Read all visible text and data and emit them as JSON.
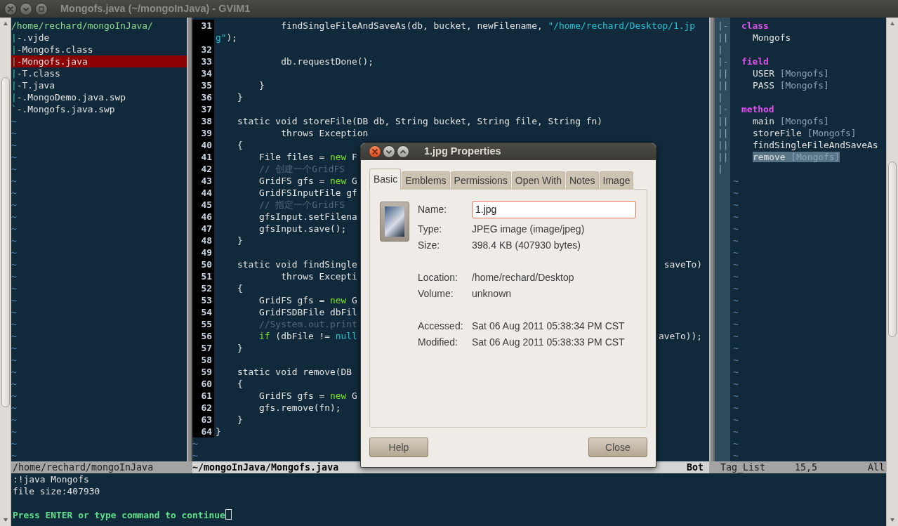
{
  "window": {
    "title": "Mongofs.java (~/mongoInJava) - GVIM1"
  },
  "file_tree": {
    "root": "/home/rechard/mongoInJava/",
    "items": [
      {
        "branch": "|",
        "name": "-.vjde",
        "selected": false
      },
      {
        "branch": "|",
        "name": "-Mongofs.class",
        "selected": false
      },
      {
        "branch": "|",
        "name": "-Mongofs.java",
        "selected": true
      },
      {
        "branch": "|",
        "name": "-T.class",
        "selected": false
      },
      {
        "branch": "|",
        "name": "-T.java",
        "selected": false
      },
      {
        "branch": "|",
        "name": "-.MongoDemo.java.swp",
        "selected": false
      },
      {
        "branch": "`",
        "name": "-.Mongofs.java.swp",
        "selected": false
      }
    ],
    "filler": [
      "~",
      "~",
      "~",
      "~",
      "~",
      "~",
      "~",
      "~",
      "~",
      "~",
      "~",
      "~",
      "~",
      "~",
      "~",
      "~",
      "~",
      "~",
      "~",
      "~",
      "~",
      "~",
      "~",
      "~",
      "~",
      "~",
      "~",
      "~",
      "~"
    ]
  },
  "editor": {
    "lines": [
      {
        "number": "31",
        "segments": [
          {
            "kind": "plain",
            "t": "            findSingleFileAndSaveAs(db, bucket, newFilename, "
          },
          {
            "kind": "string",
            "t": "\"/home/rechard/Desktop/1.jp"
          }
        ],
        "wrap": [
          {
            "kind": "string",
            "t": "g\""
          },
          {
            "kind": "plain",
            "t": ");"
          }
        ]
      },
      {
        "number": "32"
      },
      {
        "number": "33",
        "segments": [
          {
            "kind": "plain",
            "t": "            db.requestDone();"
          }
        ]
      },
      {
        "number": "34"
      },
      {
        "number": "35",
        "segments": [
          {
            "kind": "plain",
            "t": "        }"
          }
        ]
      },
      {
        "number": "36",
        "segments": [
          {
            "kind": "plain",
            "t": "    }"
          }
        ]
      },
      {
        "number": "37"
      },
      {
        "number": "38",
        "segments": [
          {
            "kind": "plain",
            "t": "    static void storeFile(DB db, String bucket, String file, String fn)"
          }
        ]
      },
      {
        "number": "39",
        "segments": [
          {
            "kind": "plain",
            "t": "            throws Exception"
          }
        ]
      },
      {
        "number": "40",
        "segments": [
          {
            "kind": "plain",
            "t": "    {"
          }
        ]
      },
      {
        "number": "41",
        "segments": [
          {
            "kind": "plain",
            "t": "        File files = "
          },
          {
            "kind": "keyword",
            "t": "new"
          },
          {
            "kind": "plain",
            "t": " F"
          }
        ]
      },
      {
        "number": "42",
        "segments": [
          {
            "kind": "comment",
            "t": "        // 创建一个GridFS"
          }
        ]
      },
      {
        "number": "43",
        "segments": [
          {
            "kind": "plain",
            "t": "        GridFS gfs = "
          },
          {
            "kind": "keyword",
            "t": "new"
          },
          {
            "kind": "plain",
            "t": " G"
          }
        ]
      },
      {
        "number": "44",
        "segments": [
          {
            "kind": "plain",
            "t": "        GridFSInputFile gf"
          }
        ]
      },
      {
        "number": "45",
        "segments": [
          {
            "kind": "comment",
            "t": "        // 指定一个GridFS"
          }
        ]
      },
      {
        "number": "46",
        "segments": [
          {
            "kind": "plain",
            "t": "        gfsInput.setFilena"
          }
        ]
      },
      {
        "number": "47",
        "segments": [
          {
            "kind": "plain",
            "t": "        gfsInput.save();"
          }
        ]
      },
      {
        "number": "48",
        "segments": [
          {
            "kind": "plain",
            "t": "    }"
          }
        ]
      },
      {
        "number": "49"
      },
      {
        "number": "50",
        "segments": [
          {
            "kind": "plain",
            "t": "    static void findSingle"
          }
        ],
        "tail": "saveTo)"
      },
      {
        "number": "51",
        "segments": [
          {
            "kind": "plain",
            "t": "            throws Excepti"
          }
        ]
      },
      {
        "number": "52",
        "segments": [
          {
            "kind": "plain",
            "t": "    {"
          }
        ]
      },
      {
        "number": "53",
        "segments": [
          {
            "kind": "plain",
            "t": "        GridFS gfs = "
          },
          {
            "kind": "keyword",
            "t": "new"
          },
          {
            "kind": "plain",
            "t": " G"
          }
        ]
      },
      {
        "number": "54",
        "segments": [
          {
            "kind": "plain",
            "t": "        GridFSDBFile dbFil"
          }
        ]
      },
      {
        "number": "55",
        "segments": [
          {
            "kind": "comment",
            "t": "        //System.out.print"
          }
        ]
      },
      {
        "number": "56",
        "segments": [
          {
            "kind": "keyword",
            "t": "        if"
          },
          {
            "kind": "plain",
            "t": " (dbFile != "
          },
          {
            "kind": "constant",
            "t": "null"
          }
        ],
        "tail": "aveTo));"
      },
      {
        "number": "57",
        "segments": [
          {
            "kind": "plain",
            "t": "    }"
          }
        ]
      },
      {
        "number": "58"
      },
      {
        "number": "59",
        "segments": [
          {
            "kind": "plain",
            "t": "    static void remove(DB"
          }
        ]
      },
      {
        "number": "60",
        "segments": [
          {
            "kind": "plain",
            "t": "    {"
          }
        ]
      },
      {
        "number": "61",
        "segments": [
          {
            "kind": "plain",
            "t": "        GridFS gfs = "
          },
          {
            "kind": "keyword",
            "t": "new"
          },
          {
            "kind": "plain",
            "t": " G"
          }
        ]
      },
      {
        "number": "62",
        "segments": [
          {
            "kind": "plain",
            "t": "        gfs.remove(fn);"
          }
        ]
      },
      {
        "number": "63",
        "segments": [
          {
            "kind": "plain",
            "t": "    }"
          }
        ]
      },
      {
        "number": "64",
        "segments": [
          {
            "kind": "plain",
            "t": "}"
          }
        ]
      }
    ],
    "filler": [
      "~",
      "~"
    ]
  },
  "tag_list": {
    "rows": [
      {
        "kind": "header",
        "fold": "|-",
        "name": "class",
        "selected": false
      },
      {
        "kind": "tag",
        "fold": "||",
        "name": "Mongofs",
        "selected": false
      },
      {
        "kind": "blank",
        "fold": "|"
      },
      {
        "kind": "header",
        "fold": "|-",
        "name": "field",
        "selected": false
      },
      {
        "kind": "tag",
        "fold": "||",
        "name": "USER",
        "scope": "[Mongofs]",
        "selected": false
      },
      {
        "kind": "tag",
        "fold": "||",
        "name": "PASS",
        "scope": "[Mongofs]",
        "selected": false
      },
      {
        "kind": "blank",
        "fold": "|"
      },
      {
        "kind": "header",
        "fold": "|-",
        "name": "method",
        "selected": false
      },
      {
        "kind": "tag",
        "fold": "||",
        "name": "main",
        "scope": "[Mongofs]",
        "selected": false
      },
      {
        "kind": "tag",
        "fold": "||",
        "name": "storeFile",
        "scope": "[Mongofs]",
        "selected": false
      },
      {
        "kind": "tag",
        "fold": "||",
        "name": "findSingleFileAndSaveAs",
        "selected": false
      },
      {
        "kind": "tag",
        "fold": "||",
        "name": "remove",
        "scope": "[Mongofs]",
        "selected": true
      },
      {
        "kind": "blank",
        "fold": "|"
      }
    ],
    "filler": [
      "~",
      "~",
      "~",
      "~",
      "~",
      "~",
      "~",
      "~",
      "~",
      "~",
      "~",
      "~",
      "~",
      "~",
      "~",
      "~",
      "~",
      "~",
      "~",
      "~",
      "~",
      "~",
      "~",
      "~"
    ]
  },
  "status_bar": {
    "tree": "/home/rechard/mongoInJava",
    "file": "~/mongoInJava/Mongofs.java",
    "position": "Bot",
    "tag_title": "Tag_List",
    "tag_cursor": "15,5",
    "tag_position": "All"
  },
  "command_output": [
    ":!java Mongofs",
    "file size:407930"
  ],
  "prompt": "Press ENTER or type command to continue",
  "dialog": {
    "title": "1.jpg Properties",
    "tabs": [
      {
        "label": "Basic",
        "selected": true
      },
      {
        "label": "Emblems",
        "selected": false
      },
      {
        "label": "Permissions",
        "selected": false
      },
      {
        "label": "Open With",
        "selected": false
      },
      {
        "label": "Notes",
        "selected": false
      },
      {
        "label": "Image",
        "selected": false
      }
    ],
    "field_groups": [
      [
        {
          "label": "Name:",
          "kind": "input",
          "value": "1.jpg"
        },
        {
          "label": "Type:",
          "kind": "text",
          "value": "JPEG image (image/jpeg)"
        },
        {
          "label": "Size:",
          "kind": "text",
          "value": "398.4 KB (407930 bytes)"
        }
      ],
      [
        {
          "label": "Location:",
          "kind": "text",
          "value": "/home/rechard/Desktop"
        },
        {
          "label": "Volume:",
          "kind": "text",
          "value": "unknown"
        }
      ],
      [
        {
          "label": "Accessed:",
          "kind": "text",
          "value": "Sat 06 Aug 2011 05:38:34 PM CST"
        },
        {
          "label": "Modified:",
          "kind": "text",
          "value": "Sat 06 Aug 2011 05:38:33 PM CST"
        }
      ]
    ],
    "buttons": [
      "Help",
      "Close"
    ]
  }
}
